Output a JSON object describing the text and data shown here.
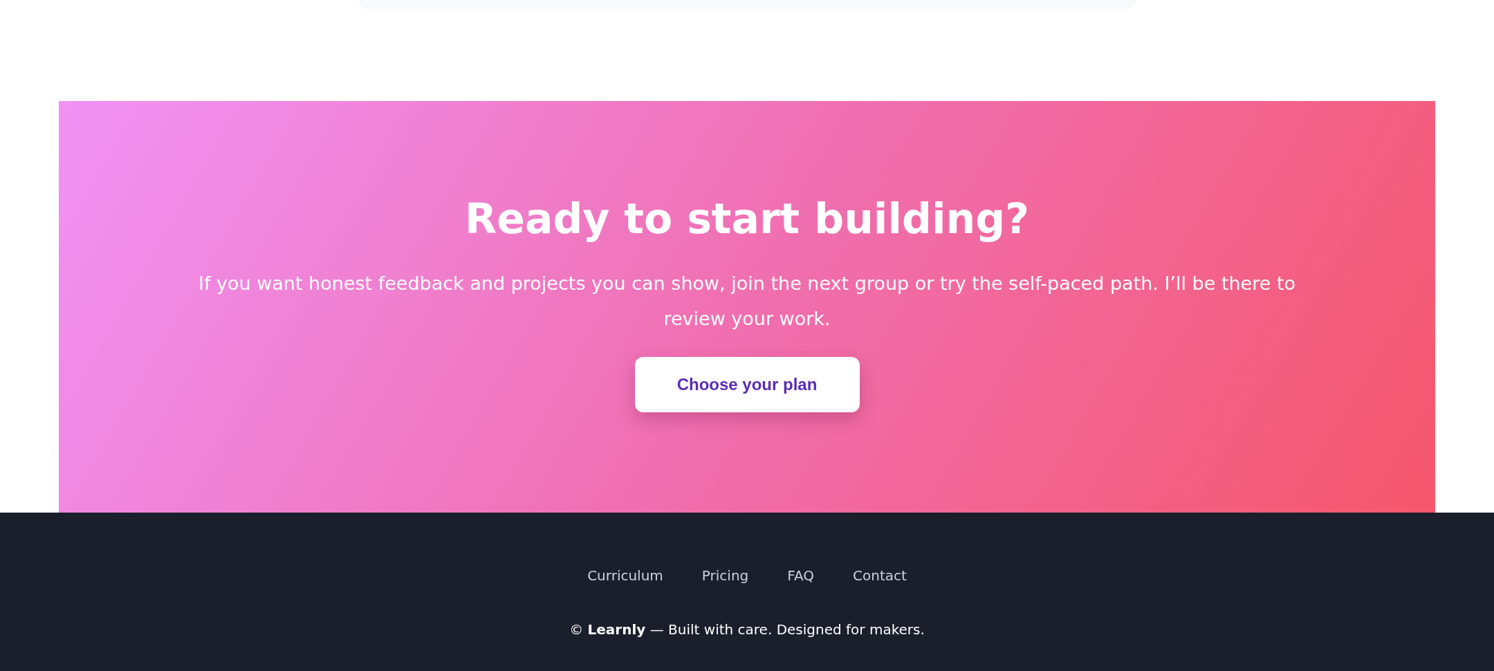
{
  "cta": {
    "title": "Ready to start building?",
    "text": "If you want honest feedback and projects you can show, join the next group or try the self-paced path. I’ll be there to review your work.",
    "button": "Choose your plan"
  },
  "footer": {
    "links": [
      "Curriculum",
      "Pricing",
      "FAQ",
      "Contact"
    ],
    "copyright": "© **Learnly** — Built with care. Designed for makers."
  }
}
